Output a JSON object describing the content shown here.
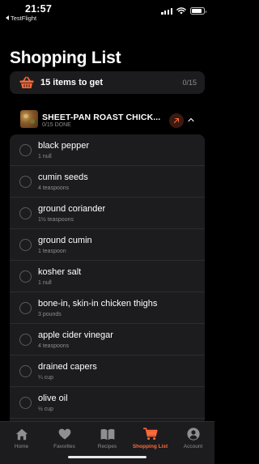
{
  "status_bar": {
    "time": "21:57",
    "back_app": "TestFlight",
    "battery_level": 0.85
  },
  "header": {
    "title": "Shopping List"
  },
  "summary": {
    "label": "15 items to get",
    "count": "0/15"
  },
  "recipe": {
    "name": "SHEET-PAN ROAST CHICK...",
    "done": "0/15 DONE"
  },
  "items": [
    {
      "name": "black pepper",
      "qty": "1 null"
    },
    {
      "name": "cumin seeds",
      "qty": "4 teaspoons"
    },
    {
      "name": "ground coriander",
      "qty": "1½ teaspoons"
    },
    {
      "name": "ground cumin",
      "qty": "1 teaspoon"
    },
    {
      "name": "kosher salt",
      "qty": "1 null"
    },
    {
      "name": "bone-in, skin-in chicken thighs",
      "qty": "3 pounds"
    },
    {
      "name": "apple cider vinegar",
      "qty": "4 teaspoons"
    },
    {
      "name": "drained capers",
      "qty": "¼ cup"
    },
    {
      "name": "olive oil",
      "qty": "½ cup"
    }
  ],
  "tabs": [
    {
      "label": "Home",
      "icon": "home-icon",
      "active": false
    },
    {
      "label": "Favorites",
      "icon": "heart-icon",
      "active": false
    },
    {
      "label": "Recipes",
      "icon": "book-icon",
      "active": false
    },
    {
      "label": "Shopping List",
      "icon": "cart-icon",
      "active": true
    },
    {
      "label": "Account",
      "icon": "person-icon",
      "active": false
    }
  ],
  "colors": {
    "accent": "#ff6a3a",
    "background": "#000000",
    "card": "#1c1c1e",
    "secondary_text": "#8e8e93"
  }
}
